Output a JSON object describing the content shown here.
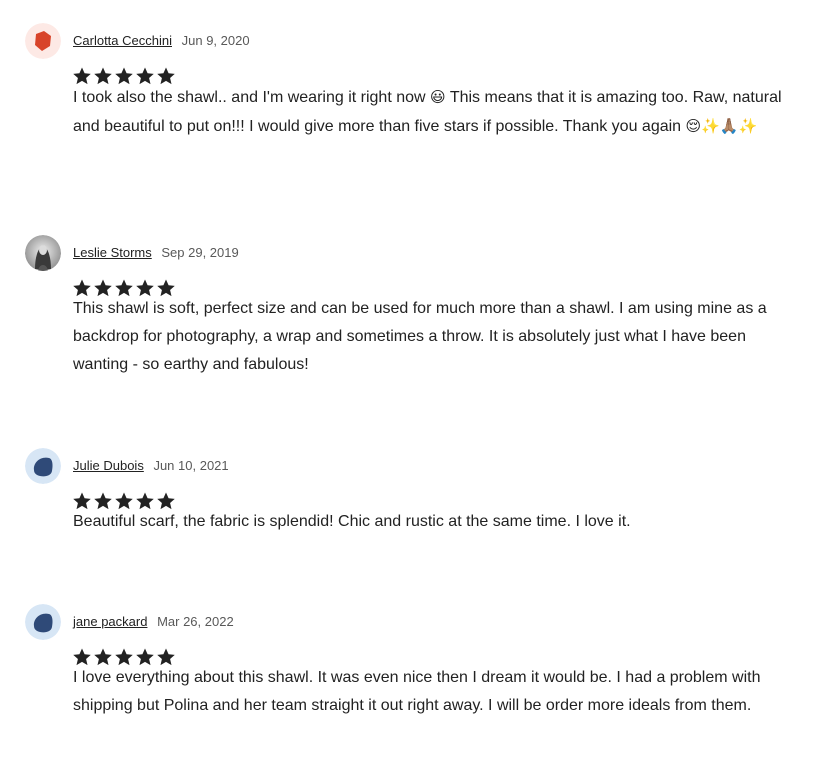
{
  "reviews": [
    {
      "reviewer": "Carlotta Cecchini",
      "date": "Jun 9, 2020",
      "rating": 5,
      "avatar_icon": "red-hexagon-avatar",
      "text_before": "I took also the shawl.. and I'm wearing it right now ",
      "emoji_1": "😃",
      "text_after": " This means that it is amazing too. Raw, natural and beautiful to put on!!! I would give more than five stars if possible. Thank you again ",
      "emoji_2": "😌✨🙏🏽✨"
    },
    {
      "reviewer": "Leslie Storms",
      "date": "Sep 29, 2019",
      "rating": 5,
      "avatar_icon": "photo-avatar",
      "text": "This shawl is soft, perfect size and can be used for much more than a shawl. I am using mine as a backdrop for photography, a wrap and sometimes a throw. It is absolutely just what I have been wanting - so earthy and fabulous!"
    },
    {
      "reviewer": "Julie Dubois",
      "date": "Jun 10, 2021",
      "rating": 5,
      "avatar_icon": "blue-blob-avatar",
      "text": "Beautiful scarf, the fabric is splendid! Chic and rustic at the same time. I love it."
    },
    {
      "reviewer": "jane packard",
      "date": "Mar 26, 2022",
      "rating": 5,
      "avatar_icon": "blue-blob-avatar",
      "text": "I love everything about this shawl. It was even nice then I dream it would be. I had a problem with shipping but Polina and her team straight it out right away. I will be order more ideals from them."
    }
  ],
  "colors": {
    "star": "#222222",
    "red_avatar_bg": "#fde9e5",
    "red_avatar_shape": "#d8442a",
    "blue_avatar_bg": "#d7e6f5",
    "blue_avatar_shape": "#2f4a78"
  }
}
